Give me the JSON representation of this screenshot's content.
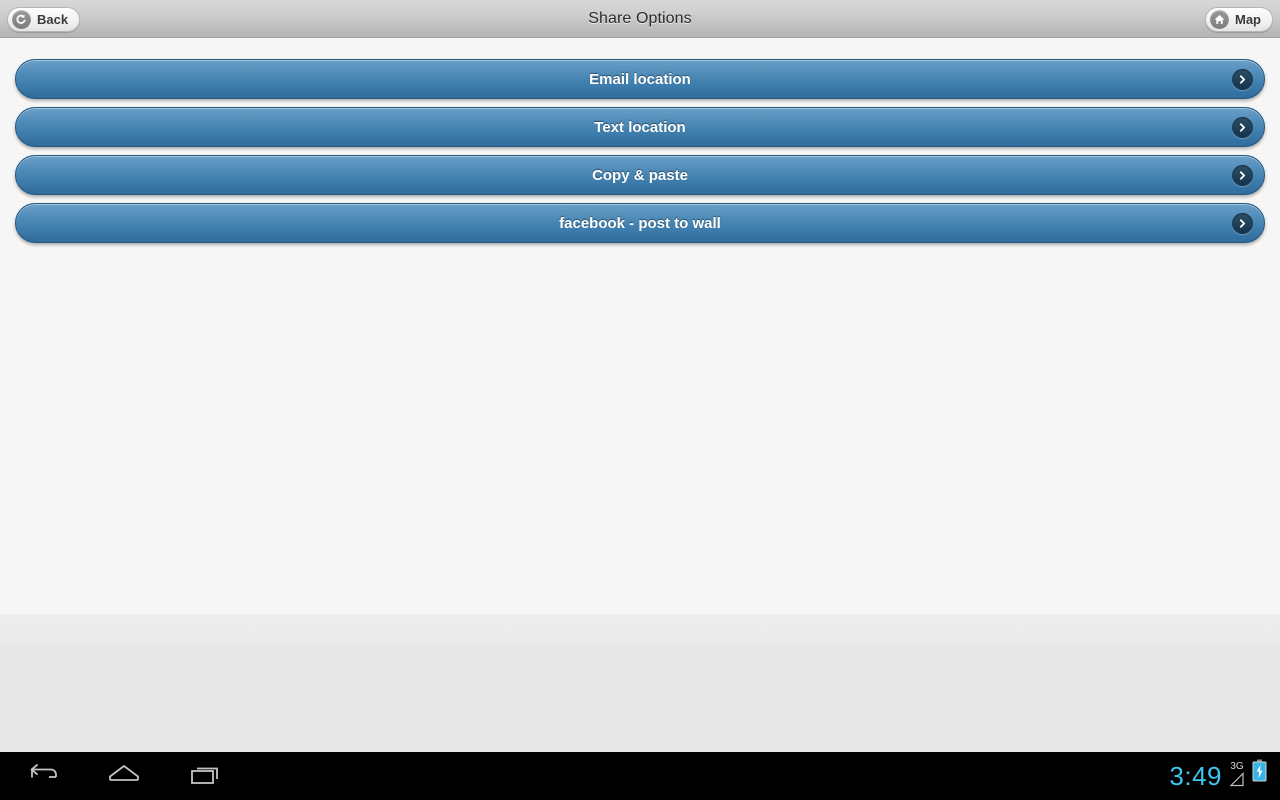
{
  "titlebar": {
    "title": "Share Options",
    "back_button": {
      "label": "Back",
      "icon": "back-arrow-icon"
    },
    "map_button": {
      "label": "Map",
      "icon": "home-icon"
    }
  },
  "share_options": {
    "items": [
      {
        "label": "Email location",
        "chevron": "chevron-right-icon"
      },
      {
        "label": "Text location",
        "chevron": "chevron-right-icon"
      },
      {
        "label": "Copy & paste",
        "chevron": "chevron-right-icon"
      },
      {
        "label": "facebook - post to wall",
        "chevron": "chevron-right-icon"
      }
    ]
  },
  "system_bar": {
    "nav": [
      {
        "name": "back-icon"
      },
      {
        "name": "home-icon"
      },
      {
        "name": "recents-icon"
      }
    ],
    "clock": "3:49",
    "network_type": "3G",
    "signal_icon": "signal-triangle-icon",
    "battery_icon": "battery-charging-icon"
  },
  "colors": {
    "accent_blue": "#3f7fae",
    "clock_cyan": "#3ec6f0",
    "battery_cyan": "#33b5e5",
    "titlebar_gray": "#cfcfcf",
    "content_bg": "#f0f0f0"
  }
}
